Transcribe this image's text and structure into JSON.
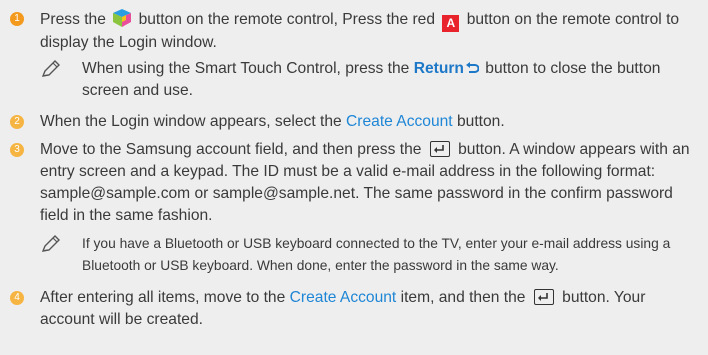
{
  "steps": [
    {
      "number": "1",
      "text_before": "Press the",
      "text_mid": "button on the remote control, Press the red",
      "red_key": "A",
      "text_after": "button on the remote control to display the Login window.",
      "note": {
        "before": "When using the Smart Touch Control, press the",
        "bold": "Return",
        "after": "button to close the button screen and use."
      }
    },
    {
      "number": "2",
      "before": "When the Login window appears, select the",
      "link": "Create Account",
      "after": "button."
    },
    {
      "number": "3",
      "before": "Move to the Samsung account field, and then press the",
      "after": "button. A window appears with an entry screen and a keypad. The ID must be a valid e-mail address in the following format: sample@sample.com or sample@sample.net. The same password in the confirm password field in the same fashion.",
      "note": "If you have a Bluetooth or USB keyboard connected to the TV, enter your e-mail address using a Bluetooth or USB keyboard. When done, enter the password in the same way."
    },
    {
      "number": "4",
      "before": "After entering all items, move to the",
      "link": "Create Account",
      "mid": "item, and then the",
      "after": "button. Your account will be created."
    }
  ],
  "colors": {
    "background": "#eeeeee",
    "text": "#3a3a3a",
    "link": "#1e86d6",
    "step_badge": "#f6b442",
    "red_key": "#e8232c"
  },
  "icons": [
    "smart-hub-icon",
    "red-a-key-icon",
    "return-icon",
    "enter-key-icon",
    "note-pen-icon"
  ]
}
